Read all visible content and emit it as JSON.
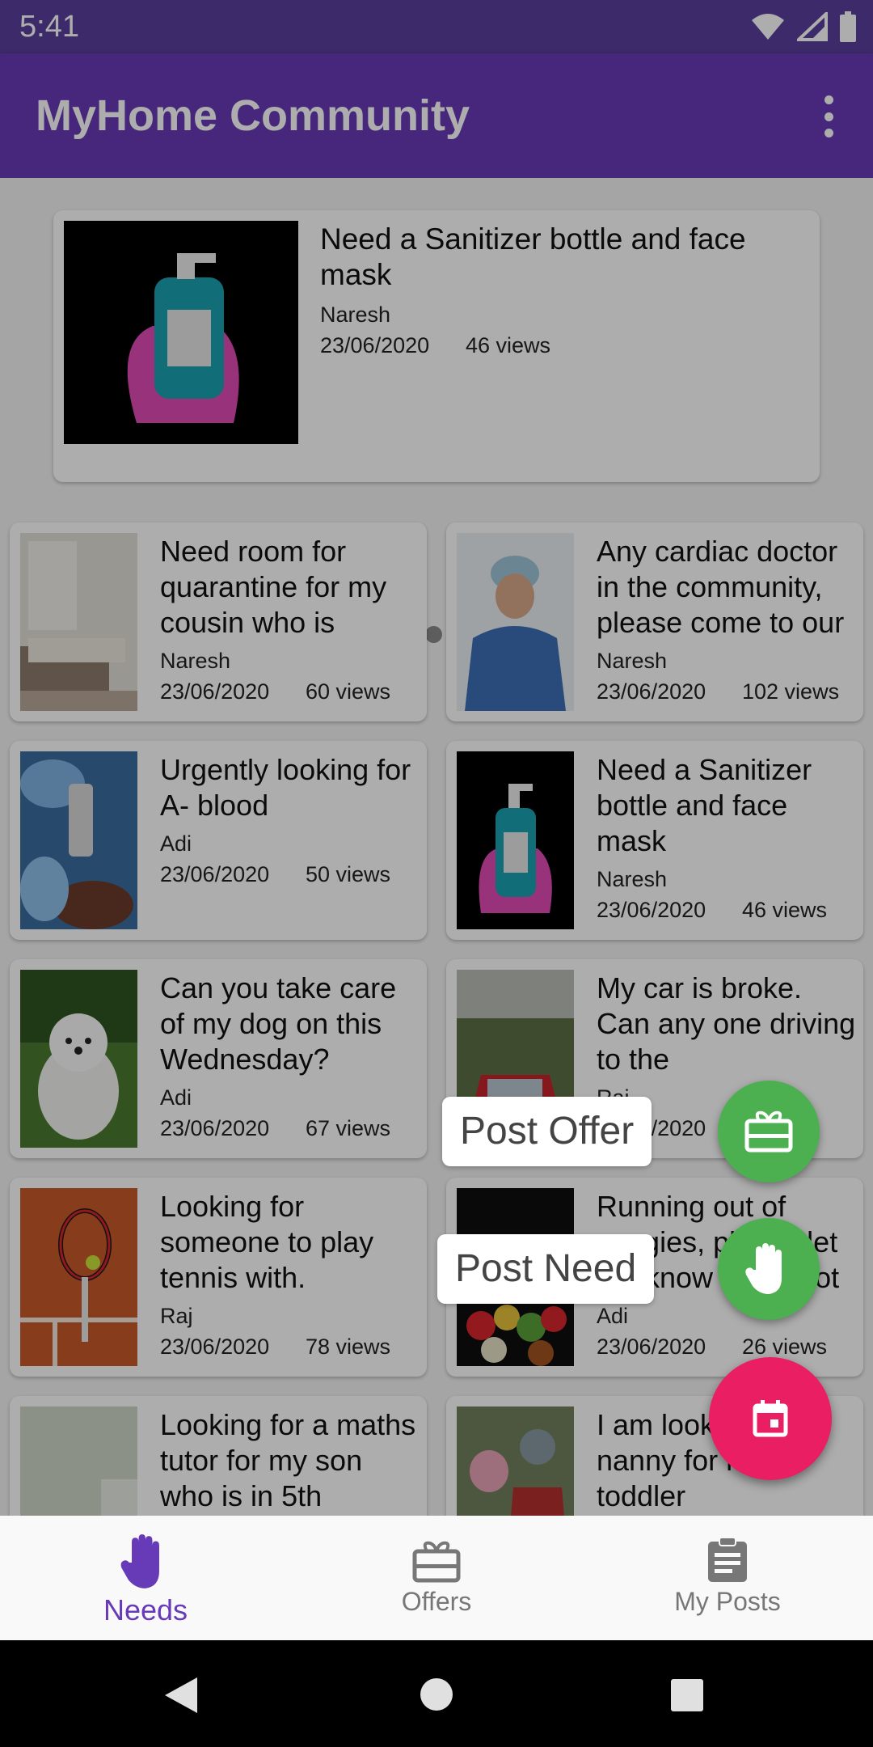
{
  "status_bar": {
    "time": "5:41"
  },
  "app_bar": {
    "title": "MyHome Community"
  },
  "featured": {
    "title": "Need a Sanitizer bottle and face mask",
    "author": "Naresh",
    "date": "23/06/2020",
    "views": "46 views",
    "carousel": {
      "count": 5,
      "active": 4
    }
  },
  "posts": [
    {
      "title": "Need room for quarantine for my cousin who is",
      "author": "Naresh",
      "date": "23/06/2020",
      "views": "60 views"
    },
    {
      "title": "Any cardiac doctor in the community, please come to our",
      "author": "Naresh",
      "date": "23/06/2020",
      "views": "102 views"
    },
    {
      "title": "Urgently looking for A- blood",
      "author": "Adi",
      "date": "23/06/2020",
      "views": "50 views"
    },
    {
      "title": "Need a Sanitizer bottle and face mask",
      "author": "Naresh",
      "date": "23/06/2020",
      "views": "46 views"
    },
    {
      "title": "Can you take care of my dog on this Wednesday?",
      "author": "Adi",
      "date": "23/06/2020",
      "views": "67 views"
    },
    {
      "title": "My car is broke. Can any one driving to the",
      "author": "Raj",
      "date": "23/06/2020",
      "views": ""
    },
    {
      "title": "Looking for someone to play tennis with.",
      "author": "Raj",
      "date": "23/06/2020",
      "views": "78 views"
    },
    {
      "title": "Running out of veggies, please let me know if you got",
      "author": "Adi",
      "date": "23/06/2020",
      "views": "26 views"
    },
    {
      "title": "Looking for a maths tutor for my son who is in 5th",
      "author": "",
      "date": "",
      "views": ""
    },
    {
      "title": "I am looking for a nanny for my toddler",
      "author": "",
      "date": "",
      "views": ""
    }
  ],
  "fab_menu": {
    "post_offer": "Post Offer",
    "post_need": "Post Need"
  },
  "bottom_nav": {
    "needs": "Needs",
    "offers": "Offers",
    "my_posts": "My Posts"
  },
  "colors": {
    "primary": "#673ab7",
    "offer_fab": "#4caf50",
    "main_fab": "#e91e63"
  }
}
